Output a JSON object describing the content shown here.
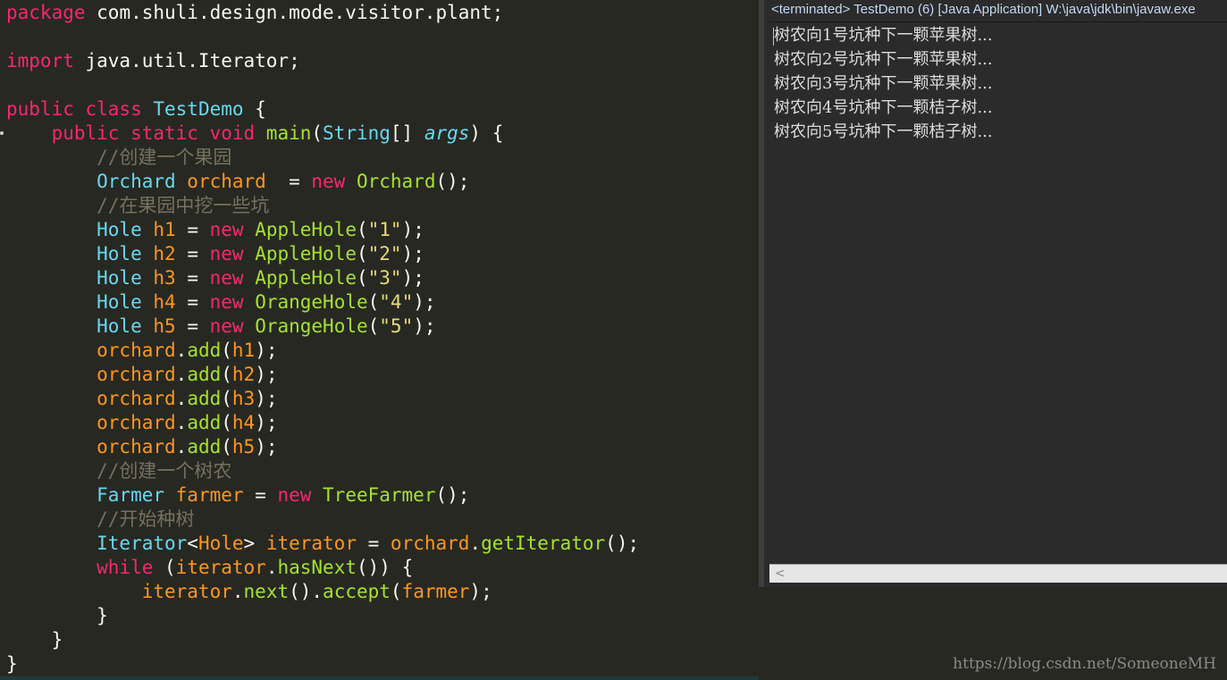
{
  "editor": {
    "lines": [
      [
        {
          "t": "package",
          "c": "kw"
        },
        {
          "t": " com.shuli.design.mode.visitor.plant;",
          "c": "plain"
        }
      ],
      [],
      [
        {
          "t": "import",
          "c": "kw"
        },
        {
          "t": " java.util.Iterator;",
          "c": "plain"
        }
      ],
      [],
      [
        {
          "t": "public class ",
          "c": "kw"
        },
        {
          "t": "TestDemo",
          "c": "cls"
        },
        {
          "t": " {",
          "c": "plain"
        }
      ],
      [
        {
          "t": "    public static void ",
          "c": "kw"
        },
        {
          "t": "main",
          "c": "def"
        },
        {
          "t": "(",
          "c": "plain"
        },
        {
          "t": "String",
          "c": "cls"
        },
        {
          "t": "[] ",
          "c": "plain"
        },
        {
          "t": "args",
          "c": "type"
        },
        {
          "t": ") {",
          "c": "plain"
        }
      ],
      [
        {
          "t": "        //创建一个果园",
          "c": "cmt"
        }
      ],
      [
        {
          "t": "        Orchard ",
          "c": "cls"
        },
        {
          "t": "orchard",
          "c": "var"
        },
        {
          "t": "  = ",
          "c": "plain"
        },
        {
          "t": "new ",
          "c": "kw"
        },
        {
          "t": "Orchard",
          "c": "def"
        },
        {
          "t": "();",
          "c": "plain"
        }
      ],
      [
        {
          "t": "        //在果园中挖一些坑",
          "c": "cmt"
        }
      ],
      [
        {
          "t": "        Hole ",
          "c": "cls"
        },
        {
          "t": "h1",
          "c": "var"
        },
        {
          "t": " = ",
          "c": "plain"
        },
        {
          "t": "new ",
          "c": "kw"
        },
        {
          "t": "AppleHole",
          "c": "def"
        },
        {
          "t": "(",
          "c": "plain"
        },
        {
          "t": "\"1\"",
          "c": "str"
        },
        {
          "t": ");",
          "c": "plain"
        }
      ],
      [
        {
          "t": "        Hole ",
          "c": "cls"
        },
        {
          "t": "h2",
          "c": "var"
        },
        {
          "t": " = ",
          "c": "plain"
        },
        {
          "t": "new ",
          "c": "kw"
        },
        {
          "t": "AppleHole",
          "c": "def"
        },
        {
          "t": "(",
          "c": "plain"
        },
        {
          "t": "\"2\"",
          "c": "str"
        },
        {
          "t": ");",
          "c": "plain"
        }
      ],
      [
        {
          "t": "        Hole ",
          "c": "cls"
        },
        {
          "t": "h3",
          "c": "var"
        },
        {
          "t": " = ",
          "c": "plain"
        },
        {
          "t": "new ",
          "c": "kw"
        },
        {
          "t": "AppleHole",
          "c": "def"
        },
        {
          "t": "(",
          "c": "plain"
        },
        {
          "t": "\"3\"",
          "c": "str"
        },
        {
          "t": ");",
          "c": "plain"
        }
      ],
      [
        {
          "t": "        Hole ",
          "c": "cls"
        },
        {
          "t": "h4",
          "c": "var"
        },
        {
          "t": " = ",
          "c": "plain"
        },
        {
          "t": "new ",
          "c": "kw"
        },
        {
          "t": "OrangeHole",
          "c": "def"
        },
        {
          "t": "(",
          "c": "plain"
        },
        {
          "t": "\"4\"",
          "c": "str"
        },
        {
          "t": ");",
          "c": "plain"
        }
      ],
      [
        {
          "t": "        Hole ",
          "c": "cls"
        },
        {
          "t": "h5",
          "c": "var"
        },
        {
          "t": " = ",
          "c": "plain"
        },
        {
          "t": "new ",
          "c": "kw"
        },
        {
          "t": "OrangeHole",
          "c": "def"
        },
        {
          "t": "(",
          "c": "plain"
        },
        {
          "t": "\"5\"",
          "c": "str"
        },
        {
          "t": ");",
          "c": "plain"
        }
      ],
      [
        {
          "t": "        orchard",
          "c": "var"
        },
        {
          "t": ".",
          "c": "plain"
        },
        {
          "t": "add",
          "c": "def"
        },
        {
          "t": "(",
          "c": "plain"
        },
        {
          "t": "h1",
          "c": "var"
        },
        {
          "t": ");",
          "c": "plain"
        }
      ],
      [
        {
          "t": "        orchard",
          "c": "var"
        },
        {
          "t": ".",
          "c": "plain"
        },
        {
          "t": "add",
          "c": "def"
        },
        {
          "t": "(",
          "c": "plain"
        },
        {
          "t": "h2",
          "c": "var"
        },
        {
          "t": ");",
          "c": "plain"
        }
      ],
      [
        {
          "t": "        orchard",
          "c": "var"
        },
        {
          "t": ".",
          "c": "plain"
        },
        {
          "t": "add",
          "c": "def"
        },
        {
          "t": "(",
          "c": "plain"
        },
        {
          "t": "h3",
          "c": "var"
        },
        {
          "t": ");",
          "c": "plain"
        }
      ],
      [
        {
          "t": "        orchard",
          "c": "var"
        },
        {
          "t": ".",
          "c": "plain"
        },
        {
          "t": "add",
          "c": "def"
        },
        {
          "t": "(",
          "c": "plain"
        },
        {
          "t": "h4",
          "c": "var"
        },
        {
          "t": ");",
          "c": "plain"
        }
      ],
      [
        {
          "t": "        orchard",
          "c": "var"
        },
        {
          "t": ".",
          "c": "plain"
        },
        {
          "t": "add",
          "c": "def"
        },
        {
          "t": "(",
          "c": "plain"
        },
        {
          "t": "h5",
          "c": "var"
        },
        {
          "t": ");",
          "c": "plain"
        }
      ],
      [
        {
          "t": "        //创建一个树农",
          "c": "cmt"
        }
      ],
      [
        {
          "t": "        Farmer ",
          "c": "cls"
        },
        {
          "t": "farmer",
          "c": "var"
        },
        {
          "t": " = ",
          "c": "plain"
        },
        {
          "t": "new ",
          "c": "kw"
        },
        {
          "t": "TreeFarmer",
          "c": "def"
        },
        {
          "t": "();",
          "c": "plain"
        }
      ],
      [
        {
          "t": "        //开始种树",
          "c": "cmt"
        }
      ],
      [
        {
          "t": "        Iterator",
          "c": "cls"
        },
        {
          "t": "<",
          "c": "plain"
        },
        {
          "t": "Hole",
          "c": "var"
        },
        {
          "t": "> ",
          "c": "plain"
        },
        {
          "t": "iterator",
          "c": "var"
        },
        {
          "t": " = ",
          "c": "plain"
        },
        {
          "t": "orchard",
          "c": "var"
        },
        {
          "t": ".",
          "c": "plain"
        },
        {
          "t": "getIterator",
          "c": "def"
        },
        {
          "t": "();",
          "c": "plain"
        }
      ],
      [
        {
          "t": "        while",
          "c": "kw"
        },
        {
          "t": " (",
          "c": "plain"
        },
        {
          "t": "iterator",
          "c": "var"
        },
        {
          "t": ".",
          "c": "plain"
        },
        {
          "t": "hasNext",
          "c": "def"
        },
        {
          "t": "()) {",
          "c": "plain"
        }
      ],
      [
        {
          "t": "            iterator",
          "c": "var"
        },
        {
          "t": ".",
          "c": "plain"
        },
        {
          "t": "next",
          "c": "def"
        },
        {
          "t": "().",
          "c": "plain"
        },
        {
          "t": "accept",
          "c": "def"
        },
        {
          "t": "(",
          "c": "plain"
        },
        {
          "t": "farmer",
          "c": "var"
        },
        {
          "t": ");",
          "c": "plain"
        }
      ],
      [
        {
          "t": "        }",
          "c": "plain"
        }
      ],
      [
        {
          "t": "    }",
          "c": "plain"
        }
      ],
      [
        {
          "t": "}",
          "c": "plain"
        }
      ]
    ]
  },
  "console": {
    "header": "<terminated> TestDemo (6) [Java Application] W:\\java\\jdk\\bin\\javaw.exe",
    "output": [
      "树农向1号坑种下一颗苹果树...",
      "树农向2号坑种下一颗苹果树...",
      "树农向3号坑种下一颗苹果树...",
      "树农向4号坑种下一颗桔子树...",
      "树农向5号坑种下一颗桔子树..."
    ],
    "scroll_left_glyph": "<"
  },
  "watermark": "https://blog.csdn.net/SomeoneMH",
  "colors": {
    "editor_bg": "#272822",
    "keyword": "#f92672",
    "class": "#66d9ef",
    "function": "#a6e22e",
    "variable": "#fd971f",
    "string": "#e6db74",
    "comment": "#75715e",
    "console_bg": "#2b2b2b",
    "console_header": "#c5d7f5"
  }
}
